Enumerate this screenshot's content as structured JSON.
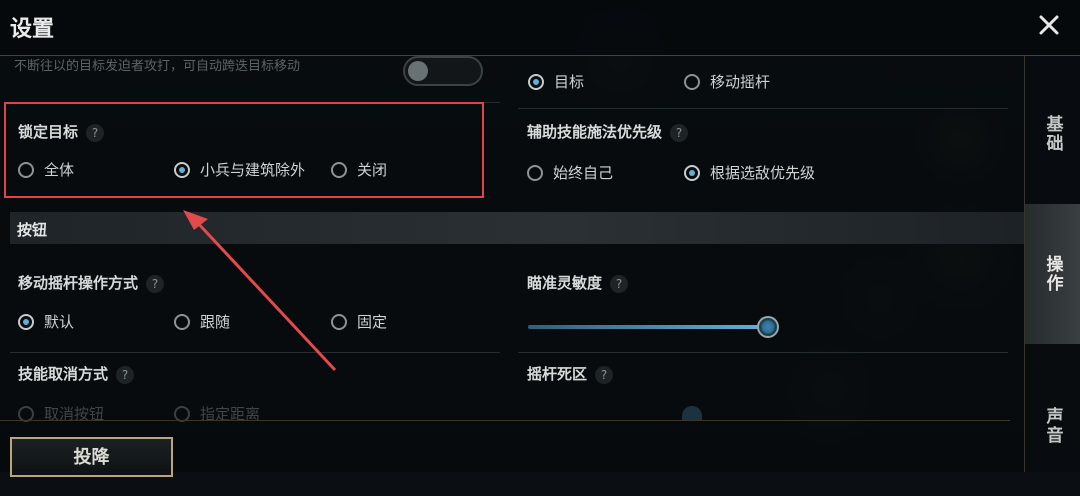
{
  "window": {
    "title": "设置"
  },
  "top_faded_text": "不断往以的目标发迫者攻打，可自动跨迭目标移动",
  "top_right_options": [
    {
      "label": "目标",
      "selected": true
    },
    {
      "label": "移动摇杆",
      "selected": false
    }
  ],
  "lock_target": {
    "label": "锁定目标",
    "help": "?",
    "options": [
      {
        "label": "全体",
        "selected": false
      },
      {
        "label": "小兵与建筑除外",
        "selected": true
      },
      {
        "label": "关闭",
        "selected": false
      }
    ]
  },
  "assist_skill": {
    "label": "辅助技能施法优先级",
    "help": "?",
    "options": [
      {
        "label": "始终自己",
        "selected": false
      },
      {
        "label": "根据选敌优先级",
        "selected": true
      }
    ]
  },
  "section": {
    "title": "按钮"
  },
  "joystick_mode": {
    "label": "移动摇杆操作方式",
    "help": "?",
    "options": [
      {
        "label": "默认",
        "selected": true
      },
      {
        "label": "跟随",
        "selected": false
      },
      {
        "label": "固定",
        "selected": false
      }
    ]
  },
  "aim_sensitivity": {
    "label": "瞄准灵敏度",
    "help": "?",
    "value_fraction": 0.95
  },
  "skill_cancel": {
    "label": "技能取消方式",
    "help": "?",
    "options": [
      {
        "label": "取消按钮",
        "selected": true
      },
      {
        "label": "指定距离",
        "selected": false
      }
    ]
  },
  "joystick_deadzone": {
    "label": "摇杆死区",
    "help": "?"
  },
  "surrender_button": "投降",
  "side_tabs": [
    {
      "label": "基础",
      "active": false
    },
    {
      "label": "操作",
      "active": true
    },
    {
      "label": "声音",
      "active": false
    }
  ],
  "colors": {
    "highlight": "#e04348",
    "accent": "#5fb0d4",
    "border_gold": "#bba67a"
  },
  "icons": {
    "close": "close-icon",
    "annotation": "red-arrow-annotation"
  }
}
